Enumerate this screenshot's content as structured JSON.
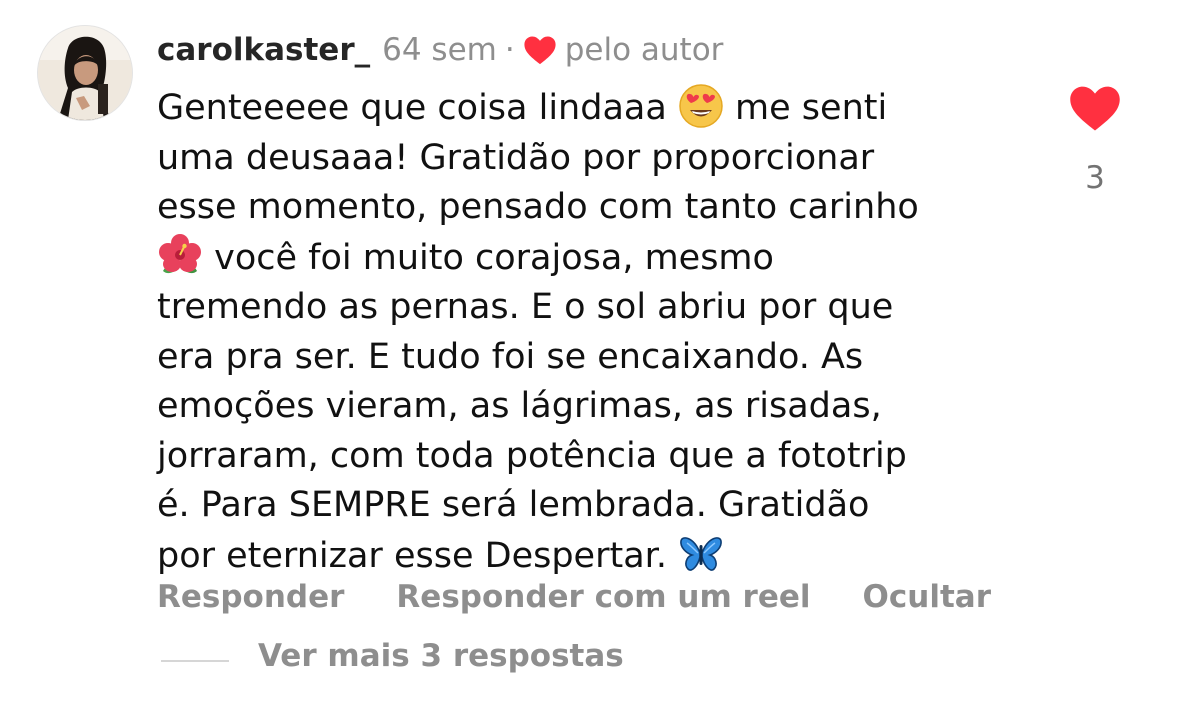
{
  "comment": {
    "username": "carolkaster_",
    "timestamp": "64 sem",
    "separator": "·",
    "liked_by_author_label": "pelo autor",
    "avatar_icon": "user-avatar-photo",
    "text_lines": [
      {
        "before": "Genteeeee que coisa lindaaa ",
        "emoji": "heart-eyes-emoji",
        "after": " me senti"
      },
      {
        "before": "uma deusaaa! Gratidão por proporcionar"
      },
      {
        "before": "esse momento, pensado com tanto carinho"
      },
      {
        "before": "",
        "emoji": "hibiscus-emoji",
        "after": " você foi muito corajosa, mesmo"
      },
      {
        "before": "tremendo as pernas.  E o sol abriu por que"
      },
      {
        "before": "era pra ser. E tudo foi se encaixando. As"
      },
      {
        "before": "emoções vieram, as lágrimas, as risadas,"
      },
      {
        "before": "jorraram, com toda potência que a fototrip"
      },
      {
        "before": "é. Para SEMPRE será lembrada. Gratidão"
      },
      {
        "before": "por eternizar esse Despertar. ",
        "emoji": "butterfly-emoji",
        "after": ""
      }
    ],
    "like_count": "3",
    "actions": {
      "reply": "Responder",
      "reply_with_reel": "Responder com um reel",
      "hide": "Ocultar"
    },
    "view_replies": "Ver mais 3 respostas"
  },
  "colors": {
    "like_red": "#ff3040",
    "secondary_text": "#8e8e8e",
    "primary_text": "#111111"
  }
}
